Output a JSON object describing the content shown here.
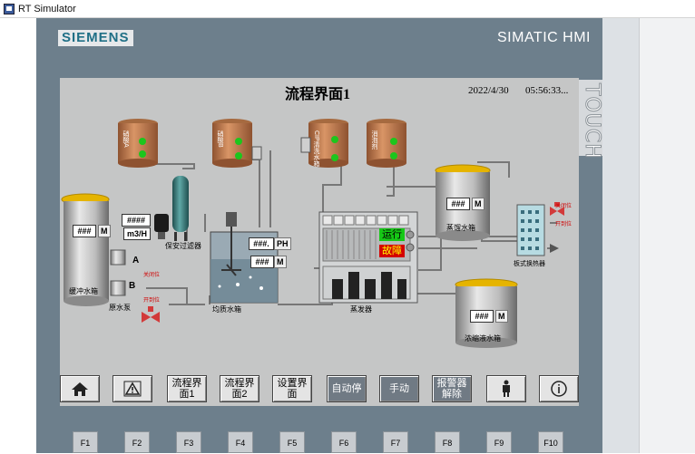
{
  "window": {
    "title": "RT Simulator",
    "icon": "rt-simulator-app-icon"
  },
  "device": {
    "brand": "SIEMENS",
    "product": "SIMATIC HMI",
    "touch_label": "TOUCH"
  },
  "screen": {
    "title": "流程界面1",
    "date": "2022/4/30",
    "time": "05:56:33..."
  },
  "tanks": {
    "t1": "硝酸A",
    "t2": "硝酸B",
    "t3": "CIP清洗水箱",
    "t4": "消泡剂"
  },
  "labels": {
    "buffer_tank": "缓冲水箱",
    "raw_pump": "原水泵",
    "security_filter": "保安过滤器",
    "equal_tank": "均质水箱",
    "evaporator": "蒸发器",
    "distilled_tank": "蒸馏水箱",
    "plate_exchanger": "板式换热器",
    "concentrate_tank": "浓缩液水箱",
    "pump_a": "A",
    "pump_b": "B",
    "valve_close_1": "关闭位",
    "valve_open_1": "开到位",
    "valve_close_2": "关闭位",
    "valve_open_2": "开到位"
  },
  "values": {
    "buffer_level": "###",
    "buffer_unit": "M",
    "flow_value": "####",
    "flow_unit": "m3/H",
    "equal_ph": "###.",
    "equal_ph_unit": "PH",
    "equal_level": "###",
    "equal_level_unit": "M",
    "distilled_level": "###",
    "distilled_unit": "M",
    "concentrate_level": "###",
    "concentrate_unit": "M"
  },
  "status": {
    "running": "运行",
    "fault": "故障"
  },
  "colors": {
    "running_bg": "#16c816",
    "fault_bg": "#d40000",
    "indicator_green": "#1cc61c",
    "tank_brown": "#c07a48"
  },
  "nav": {
    "home_icon": "home-icon",
    "alarm_icon": "warning-icon",
    "flow1": "流程界面1",
    "flow2": "流程界面2",
    "settings": "设置界面",
    "auto_stop": "自动停",
    "manual": "手动",
    "alarm_reset": "报警器解除",
    "user_icon": "user-icon",
    "info_icon": "info-icon"
  },
  "fkeys": [
    "F1",
    "F2",
    "F3",
    "F4",
    "F5",
    "F6",
    "F7",
    "F8",
    "F9",
    "F10"
  ]
}
